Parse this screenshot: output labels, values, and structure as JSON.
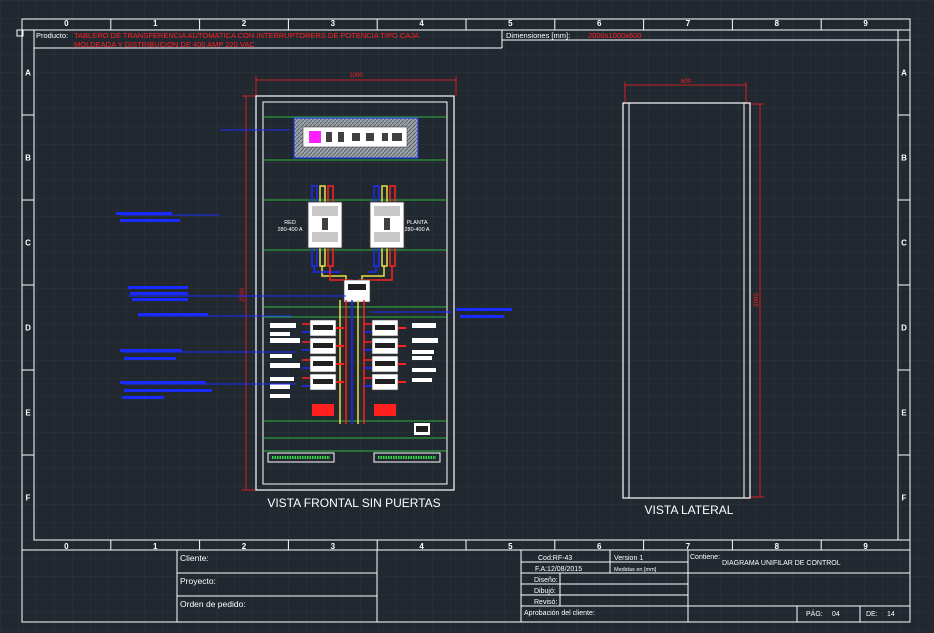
{
  "header": {
    "product_label": "Producto:",
    "product_line1": "TABLERO DE TRANSFERENCIA AUTOMATICA CON INTERRUPTORERS DE POTENCIA TIPO CAJA",
    "product_line2": "MOLDEADA Y DISTRIBUCION DE 400 AMP 220 VAC",
    "dimensions_label": "Dimensiones [mm]:",
    "dimensions_value": "2000x1000x600"
  },
  "grid": {
    "columns": [
      "0",
      "1",
      "2",
      "3",
      "4",
      "5",
      "6",
      "7",
      "8",
      "9"
    ],
    "rows": [
      "A",
      "B",
      "C",
      "D",
      "E",
      "F"
    ]
  },
  "front_view": {
    "title": "VISTA FRONTAL SIN PUERTAS",
    "width_dim": "1000",
    "height_dim": "2000",
    "breaker_left": {
      "name": "RED",
      "rating": "280-400 A"
    },
    "breaker_right": {
      "name": "PLANTA",
      "rating": "280-400 A"
    }
  },
  "side_view": {
    "title": "VISTA LATERAL",
    "width_dim": "600",
    "height_dim": "2000"
  },
  "title_block": {
    "cliente_label": "Cliente:",
    "proyecto_label": "Proyecto:",
    "orden_label": "Orden de pedido:",
    "cod": "Cod:RF-43",
    "version": "Version 1",
    "fa": "F.A:12/08/2015",
    "medidas": "Medidas en [mm]",
    "diseno_label": "Diseño:",
    "dibujo_label": "Dibujó:",
    "reviso_label": "Revisó:",
    "aprobacion_label": "Aprobación del cliente:",
    "contiene_label": "Contiene:",
    "contiene_value": "DIAGRAMA UNIFILAR DE CONTROL",
    "pag_label": "PÁG:",
    "pag_value": "04",
    "de_label": "DE:",
    "de_value": "14"
  },
  "colors": {
    "background": "#212830",
    "line": "#ffffff",
    "accent_red": "#ff2020",
    "blue": "#1a2bff",
    "green": "#30e040",
    "yellow": "#e8e040",
    "magenta": "#ff20ff"
  }
}
